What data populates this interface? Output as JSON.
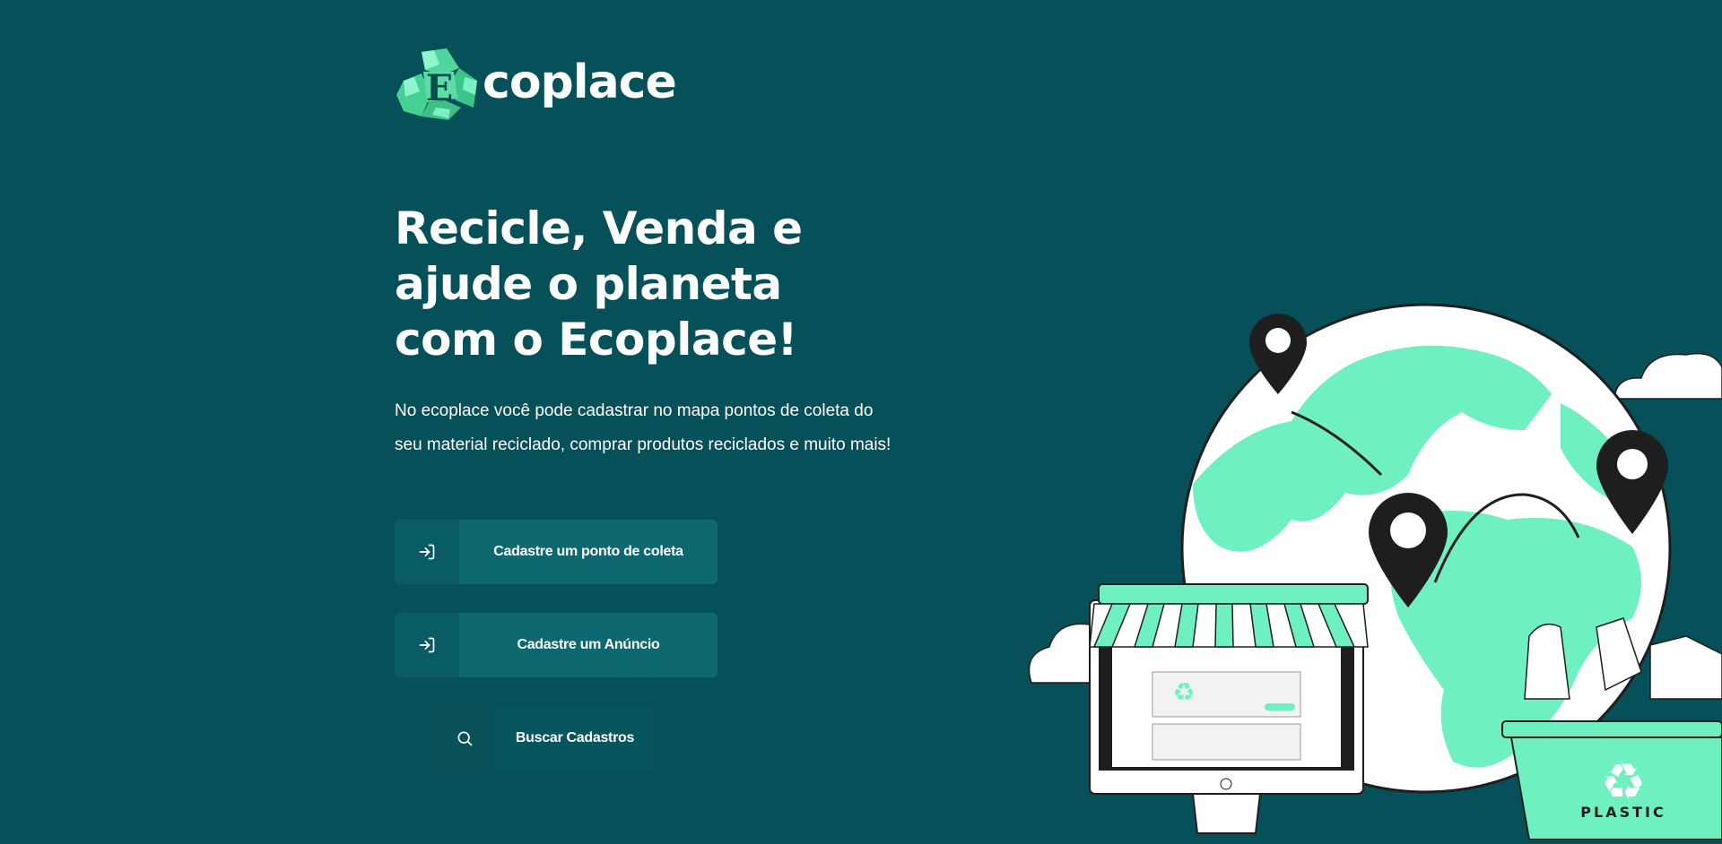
{
  "brand": {
    "logo_letter": "E",
    "name": "coplace"
  },
  "hero": {
    "title": "Recicle, Venda e ajude o planeta com o Ecoplace!",
    "description": "No ecoplace você pode cadastrar no mapa pontos de coleta do seu material reciclado, comprar produtos reciclados e muito mais!"
  },
  "actions": [
    {
      "label": "Cadastre um ponto de coleta",
      "icon": "sign-in-icon"
    },
    {
      "label": "Cadastre um Anúncio",
      "icon": "sign-in-icon"
    },
    {
      "label": "Buscar Cadastros",
      "icon": "search-icon"
    }
  ],
  "illustration": {
    "bin_label": "PLASTIC"
  },
  "colors": {
    "background": "#065059",
    "button": "#0d6870",
    "accent": "#6ff0c0",
    "dark": "#1e1e1e"
  }
}
